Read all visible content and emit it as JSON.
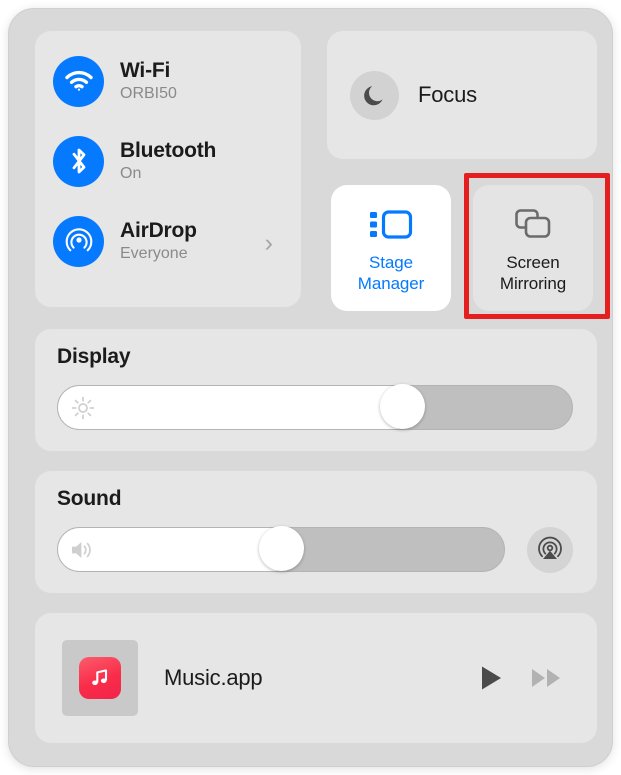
{
  "panel": {
    "name": "Control Center",
    "background_color": "#d9d9d9",
    "card_color": "#e6e6e6"
  },
  "connectivity": {
    "items": [
      {
        "icon": "wifi-icon",
        "title": "Wi-Fi",
        "subtitle": "ORBI50",
        "icon_color": "#057aff",
        "chevron": ""
      },
      {
        "icon": "bluetooth-icon",
        "title": "Bluetooth",
        "subtitle": "On",
        "icon_color": "#057aff",
        "chevron": ""
      },
      {
        "icon": "airdrop-icon",
        "title": "AirDrop",
        "subtitle": "Everyone",
        "icon_color": "#057aff",
        "chevron": "›"
      }
    ]
  },
  "focus": {
    "label": "Focus",
    "icon": "moon-icon",
    "icon_color": "#4b4b4b",
    "icon_background": "#d2d2d2"
  },
  "tiles": [
    {
      "name": "stage-manager",
      "label_line1": "Stage",
      "label_line2": "Manager",
      "icon": "stage-manager-icon",
      "active": true,
      "accent_color": "#057aff",
      "background": "#ffffff"
    },
    {
      "name": "screen-mirroring",
      "label_line1": "Screen",
      "label_line2": "Mirroring",
      "icon": "screen-mirroring-icon",
      "active": false,
      "accent_color": "#6b6b6b",
      "background": "#e4e4e4"
    }
  ],
  "highlight": {
    "target": "screen-mirroring",
    "color": "#e51f1f",
    "thickness_px": 5
  },
  "display": {
    "title": "Display",
    "slider_glyph": "brightness-icon",
    "value_percent": 67
  },
  "sound": {
    "title": "Sound",
    "slider_glyph": "speaker-wave-icon",
    "value_percent": 50,
    "output_button_icon": "airplay-audio-icon"
  },
  "now_playing": {
    "app_name": "Music.app",
    "app_icon": "music-note-icon",
    "app_icon_color": "#f92c49",
    "controls": [
      {
        "name": "play-button",
        "icon": "play-icon",
        "enabled": true
      },
      {
        "name": "next-button",
        "icon": "forward-icon",
        "enabled": false
      }
    ]
  }
}
